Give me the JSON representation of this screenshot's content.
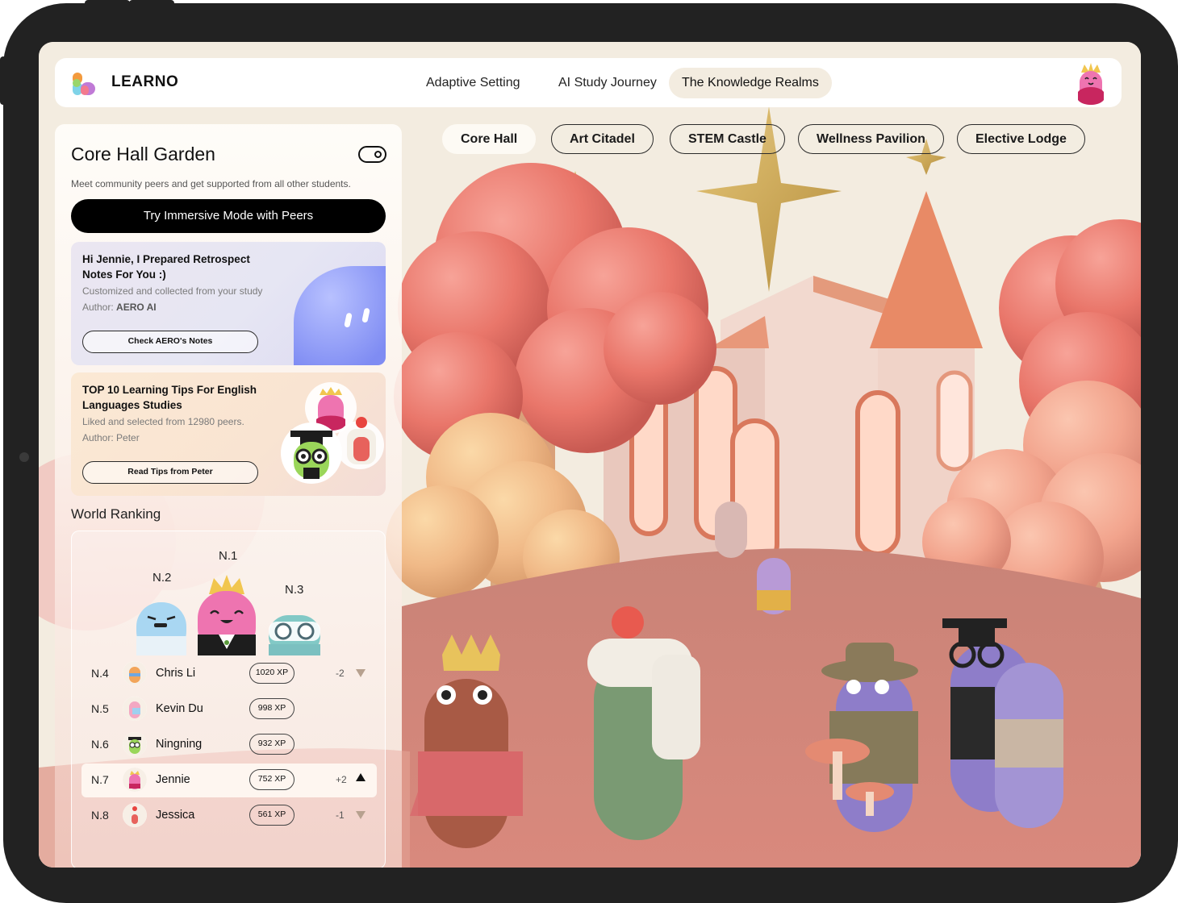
{
  "app": {
    "brand": "LEARNO"
  },
  "nav": {
    "items": [
      {
        "label": "Adaptive Setting"
      },
      {
        "label": "AI Study Journey"
      },
      {
        "label": "The Knowledge Realms"
      }
    ],
    "active_item": "The Knowledge Realms"
  },
  "realms": {
    "tabs": [
      {
        "label": "Core Hall"
      },
      {
        "label": "Art Citadel"
      },
      {
        "label": "STEM Castle"
      },
      {
        "label": "Wellness Pavilion"
      },
      {
        "label": "Elective Lodge"
      }
    ],
    "active_tab": "Core Hall"
  },
  "panel": {
    "title": "Core Hall Garden",
    "subtitle": "Meet community peers and get supported from all other students.",
    "immersive_button": "Try Immersive Mode with Peers"
  },
  "cards": [
    {
      "title": "Hi Jennie, I Prepared Retrospect Notes For You :)",
      "description": "Customized and collected from your study",
      "author_prefix": "Author: ",
      "author": "AERO AI",
      "button": "Check AERO's Notes"
    },
    {
      "title": "TOP 10 Learning Tips For English Languages Studies",
      "description": "Liked and selected from 12980 peers.",
      "author_prefix": "Author: ",
      "author": "Peter",
      "button": "Read Tips from Peter"
    }
  ],
  "ranking": {
    "title": "World Ranking",
    "podium": [
      {
        "label": "N.1"
      },
      {
        "label": "N.2"
      },
      {
        "label": "N.3"
      }
    ],
    "rows": [
      {
        "rank": "N.4",
        "name": "Chris Li",
        "xp": "1020 XP",
        "change": "-2",
        "direction": "down"
      },
      {
        "rank": "N.5",
        "name": "Kevin Du",
        "xp": "998 XP",
        "change": "",
        "direction": "none"
      },
      {
        "rank": "N.6",
        "name": "Ningning",
        "xp": "932 XP",
        "change": "",
        "direction": "none"
      },
      {
        "rank": "N.7",
        "name": "Jennie",
        "xp": "752 XP",
        "change": "+2",
        "direction": "up",
        "highlight": true
      },
      {
        "rank": "N.8",
        "name": "Jessica",
        "xp": "561 XP",
        "change": "-1",
        "direction": "down"
      }
    ]
  },
  "colors": {
    "accent_dark": "#000000",
    "background": "#f3ece0",
    "tree_red": "#e9776c",
    "ground": "#d4857a"
  },
  "icons": {
    "toggle": "toggle-icon",
    "logo": "learno-logo-icon",
    "arrow_down": "triangle-down-icon",
    "arrow_up": "triangle-up-icon"
  }
}
